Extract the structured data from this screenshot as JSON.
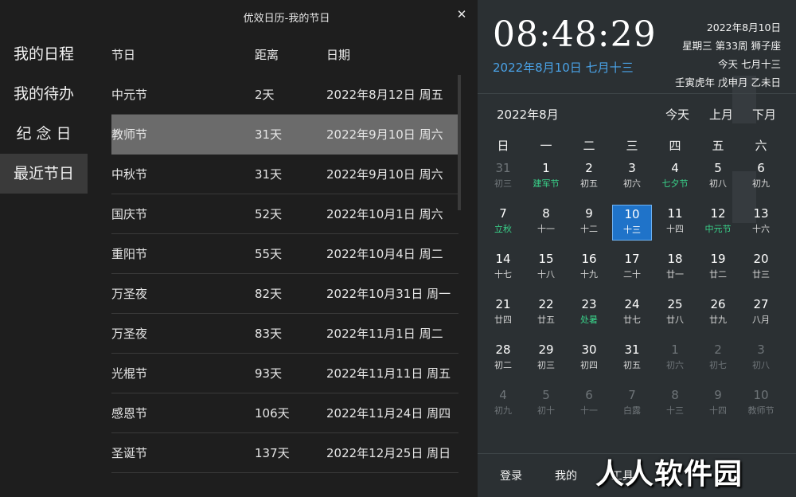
{
  "window": {
    "title": "优效日历-我的节日",
    "close_glyph": "✕"
  },
  "sidebar": {
    "items": [
      {
        "label": "我的日程"
      },
      {
        "label": "我的待办"
      },
      {
        "label": "纪 念 日"
      },
      {
        "label": "最近节日"
      }
    ],
    "active_index": 3
  },
  "table": {
    "headers": {
      "name": "节日",
      "distance": "距离",
      "date": "日期"
    },
    "rows": [
      {
        "name": "中元节",
        "distance": "2天",
        "date": "2022年8月12日 周五"
      },
      {
        "name": "教师节",
        "distance": "31天",
        "date": "2022年9月10日 周六"
      },
      {
        "name": "中秋节",
        "distance": "31天",
        "date": "2022年9月10日 周六"
      },
      {
        "name": "国庆节",
        "distance": "52天",
        "date": "2022年10月1日 周六"
      },
      {
        "name": "重阳节",
        "distance": "55天",
        "date": "2022年10月4日 周二"
      },
      {
        "name": "万圣夜",
        "distance": "82天",
        "date": "2022年10月31日 周一"
      },
      {
        "name": "万圣夜",
        "distance": "83天",
        "date": "2022年11月1日 周二"
      },
      {
        "name": "光棍节",
        "distance": "93天",
        "date": "2022年11月11日 周五"
      },
      {
        "name": "感恩节",
        "distance": "106天",
        "date": "2022年11月24日 周四"
      },
      {
        "name": "圣诞节",
        "distance": "137天",
        "date": "2022年12月25日 周日"
      }
    ],
    "selected_index": 1
  },
  "clock": {
    "time": "08:48:29",
    "date_line": "2022年8月10日 七月十三",
    "info": [
      "2022年8月10日",
      "星期三 第33周 狮子座",
      "今天 七月十三",
      "壬寅虎年 戊申月 乙未日"
    ]
  },
  "calendar": {
    "month_title": "2022年8月",
    "nav": {
      "today": "今天",
      "prev": "上月",
      "next": "下月"
    },
    "weekdays": [
      "日",
      "一",
      "二",
      "三",
      "四",
      "五",
      "六"
    ],
    "weeks": [
      [
        {
          "d": "31",
          "l": "初三",
          "dim": true
        },
        {
          "d": "1",
          "l": "建军节",
          "fest": true
        },
        {
          "d": "2",
          "l": "初五"
        },
        {
          "d": "3",
          "l": "初六"
        },
        {
          "d": "4",
          "l": "七夕节",
          "fest": true
        },
        {
          "d": "5",
          "l": "初八"
        },
        {
          "d": "6",
          "l": "初九"
        }
      ],
      [
        {
          "d": "7",
          "l": "立秋",
          "fest": true
        },
        {
          "d": "8",
          "l": "十一"
        },
        {
          "d": "9",
          "l": "十二"
        },
        {
          "d": "10",
          "l": "十三",
          "today": true
        },
        {
          "d": "11",
          "l": "十四"
        },
        {
          "d": "12",
          "l": "中元节",
          "fest": true
        },
        {
          "d": "13",
          "l": "十六"
        }
      ],
      [
        {
          "d": "14",
          "l": "十七"
        },
        {
          "d": "15",
          "l": "十八"
        },
        {
          "d": "16",
          "l": "十九"
        },
        {
          "d": "17",
          "l": "二十"
        },
        {
          "d": "18",
          "l": "廿一"
        },
        {
          "d": "19",
          "l": "廿二"
        },
        {
          "d": "20",
          "l": "廿三"
        }
      ],
      [
        {
          "d": "21",
          "l": "廿四"
        },
        {
          "d": "22",
          "l": "廿五"
        },
        {
          "d": "23",
          "l": "处暑",
          "fest": true
        },
        {
          "d": "24",
          "l": "廿七"
        },
        {
          "d": "25",
          "l": "廿八"
        },
        {
          "d": "26",
          "l": "廿九"
        },
        {
          "d": "27",
          "l": "八月"
        }
      ],
      [
        {
          "d": "28",
          "l": "初二"
        },
        {
          "d": "29",
          "l": "初三"
        },
        {
          "d": "30",
          "l": "初四"
        },
        {
          "d": "31",
          "l": "初五"
        },
        {
          "d": "1",
          "l": "初六",
          "dim": true
        },
        {
          "d": "2",
          "l": "初七",
          "dim": true
        },
        {
          "d": "3",
          "l": "初八",
          "dim": true
        }
      ],
      [
        {
          "d": "4",
          "l": "初九",
          "dim": true
        },
        {
          "d": "5",
          "l": "初十",
          "dim": true
        },
        {
          "d": "6",
          "l": "十一",
          "dim": true
        },
        {
          "d": "7",
          "l": "白露",
          "dim": true
        },
        {
          "d": "8",
          "l": "十三",
          "dim": true
        },
        {
          "d": "9",
          "l": "十四",
          "dim": true
        },
        {
          "d": "10",
          "l": "教师节",
          "dim": true
        }
      ]
    ]
  },
  "bottom_bar": {
    "login": "登录",
    "mine": "我的",
    "tools": "工具"
  },
  "watermark": "人人软件园",
  "colors": {
    "accent": "#1f73c9",
    "festival": "#39d28a",
    "date_blue": "#4aa3e8"
  }
}
